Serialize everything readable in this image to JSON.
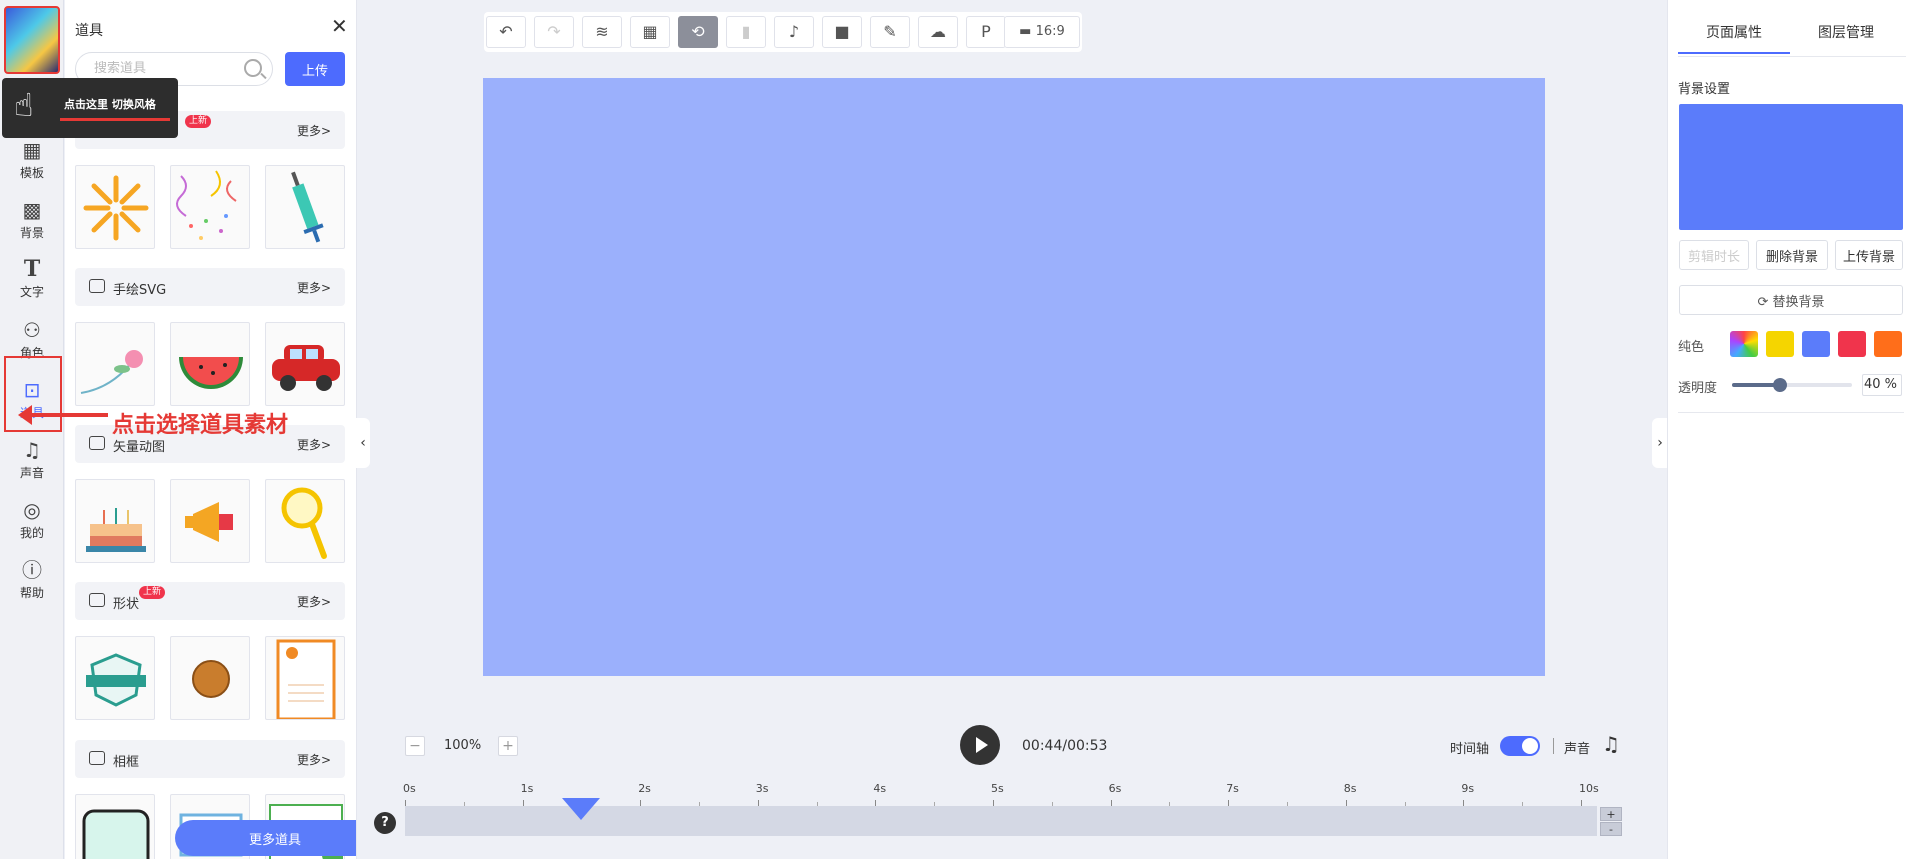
{
  "rail": {
    "items": [
      {
        "label": "模板",
        "icon": "grid-icon"
      },
      {
        "label": "背景",
        "icon": "checker-icon"
      },
      {
        "label": "文字",
        "icon": "text-icon"
      },
      {
        "label": "角色",
        "icon": "people-icon"
      },
      {
        "label": "道具",
        "icon": "briefcase-icon"
      },
      {
        "label": "声音",
        "icon": "music-icon"
      },
      {
        "label": "我的",
        "icon": "user-icon"
      },
      {
        "label": "帮助",
        "icon": "help-icon"
      }
    ]
  },
  "tooltip": {
    "text": "点击这里  切换风格"
  },
  "annotation": {
    "text": "点击选择道具素材"
  },
  "panel": {
    "title": "道具",
    "search_placeholder": "搜索道具",
    "upload_label": "上传",
    "sections": [
      {
        "title": "",
        "more": "更多>",
        "badge": "上新"
      },
      {
        "title": "手绘SVG",
        "more": "更多>"
      },
      {
        "title": "矢量动图",
        "more": "更多>"
      },
      {
        "title": "形状",
        "more": "更多>",
        "badge": "上新"
      },
      {
        "title": "相框",
        "more": "更多>"
      }
    ],
    "more_props": "更多道具"
  },
  "toolbar": {
    "buttons": [
      "undo-icon",
      "redo-icon",
      "layers-icon",
      "grid-icon",
      "magnet-icon",
      "paint-roller-icon",
      "mic-icon",
      "camera-icon",
      "pencil-icon",
      "cloud-upload-icon",
      "parking-icon"
    ],
    "ratio": "16:9"
  },
  "playback": {
    "zoom": "100%",
    "time": "00:44/00:53",
    "timeline_label": "时间轴",
    "timeline_on": true,
    "sound_label": "声音"
  },
  "timeline": {
    "ticks": [
      "0s",
      "1s",
      "2s",
      "3s",
      "4s",
      "5s",
      "6s",
      "7s",
      "8s",
      "9s",
      "10s"
    ],
    "playhead_seconds": 1.5
  },
  "right_panel": {
    "tabs": [
      "页面属性",
      "图层管理"
    ],
    "bg_settings": "背景设置",
    "btn_trim": "剪辑时长",
    "btn_delete": "删除背景",
    "btn_upload": "上传背景",
    "btn_replace": "替换背景",
    "solid_label": "纯色",
    "swatches": [
      "#f5d500",
      "#5b7cfa",
      "#f0344c",
      "#ff6e1a"
    ],
    "opacity_label": "透明度",
    "opacity_value": "40",
    "opacity_unit": "%"
  },
  "colors": {
    "accent": "#4d6bfe",
    "canvas": "#9bb0fc",
    "bg_preview": "#5b7cfa"
  }
}
